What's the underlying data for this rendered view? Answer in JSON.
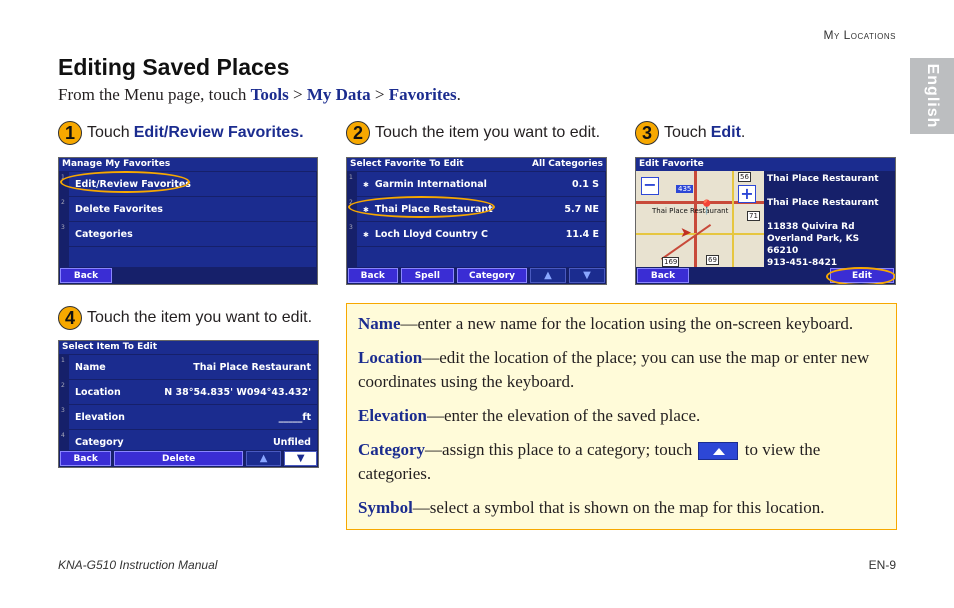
{
  "header": {
    "section": "My Locations",
    "language_tab": "English"
  },
  "title": "Editing Saved Places",
  "intro": {
    "text": "From the Menu page, touch ",
    "tools": "Tools",
    "sep1": " > ",
    "mydata": "My Data",
    "sep2": " > ",
    "favorites": "Favorites",
    "end": "."
  },
  "steps": [
    {
      "num": "1",
      "prefix": "Touch",
      "bold": "Edit/Review Favorites."
    },
    {
      "num": "2",
      "prefix": "Touch the item you want to edit."
    },
    {
      "num": "3",
      "prefix": "Touch",
      "bold": "Edit",
      "suffix": "."
    },
    {
      "num": "4",
      "prefix": "Touch the item you want to edit."
    }
  ],
  "screen1": {
    "title": "Manage My Favorites",
    "items": [
      "Edit/Review Favorites",
      "Delete Favorites",
      "Categories"
    ],
    "back": "Back"
  },
  "screen2": {
    "title": "Select Favorite To Edit",
    "filter": "All Categories",
    "items": [
      {
        "name": "Garmin International",
        "dist": "0.1",
        "dir": "S"
      },
      {
        "name": "Thai Place Restaurant",
        "dist": "5.7",
        "dir": "NE"
      },
      {
        "name": "Loch Lloyd Country C",
        "dist": "11.4",
        "dir": "E"
      }
    ],
    "buttons": [
      "Back",
      "Spell",
      "Category"
    ]
  },
  "screen3": {
    "title": "Edit Favorite",
    "name_a": "Thai Place Restaurant",
    "name_b": "Thai Place Restaurant",
    "address1": "11838 Quivira Rd",
    "address2": "Overland Park, KS 66210",
    "phone": "913-451-8421",
    "back": "Back",
    "edit": "Edit",
    "map_label": "Thai Place Restaurant",
    "shields": [
      "435",
      "56",
      "71",
      "169",
      "69"
    ]
  },
  "screen4": {
    "title": "Select Item To Edit",
    "rows": [
      {
        "label": "Name",
        "value": "Thai Place Restaurant"
      },
      {
        "label": "Location",
        "value": "N 38°54.835' W094°43.432'"
      },
      {
        "label": "Elevation",
        "value": "_____ft"
      },
      {
        "label": "Category",
        "value": "Unfiled"
      }
    ],
    "buttons": [
      "Back",
      "Delete"
    ]
  },
  "descriptions": {
    "name_term": "Name",
    "name_text": "—enter a new name for the location using the on-screen keyboard.",
    "location_term": "Location",
    "location_text": "—edit the location of the place; you can use the map or enter new coordinates using the keyboard.",
    "elevation_term": "Elevation",
    "elevation_text": "—enter the elevation of the saved place.",
    "category_term": "Category",
    "category_text_a": "—assign this place to a category; touch",
    "category_text_b": "to view the categories.",
    "symbol_term": "Symbol",
    "symbol_text": "—select a symbol that is shown on the map for this location."
  },
  "footer": {
    "manual": "KNA-G510 Instruction Manual",
    "page": "EN-9"
  }
}
